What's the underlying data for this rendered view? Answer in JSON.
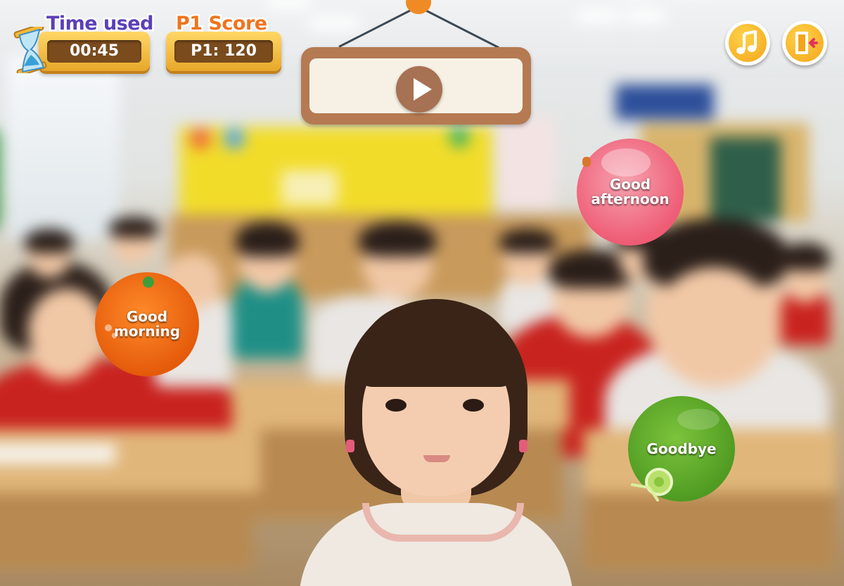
{
  "hud": {
    "time_label": "Time used",
    "time_value": "00:45",
    "score_label": "P1 Score",
    "score_value": "P1: 120"
  },
  "controls": {
    "play_icon": "play-icon",
    "music_icon": "music-note-icon",
    "exit_icon": "exit-door-icon"
  },
  "answers": [
    {
      "label": "Good afternoon",
      "color": "#f06d82"
    },
    {
      "label": "Good morning",
      "color": "#ee6a10"
    },
    {
      "label": "Goodbye",
      "color": "#62a82c"
    }
  ],
  "colors": {
    "time_label": "#5b3fb8",
    "score_label": "#f0741f",
    "hud_gold": "#f2b93a",
    "hud_inner": "#7a4b1d",
    "sign_wood": "#b57a52"
  }
}
